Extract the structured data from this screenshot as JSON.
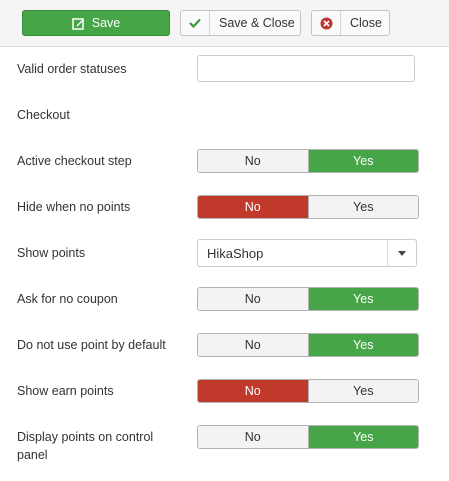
{
  "toolbar": {
    "save": {
      "label": "Save",
      "icon": "edit-icon"
    },
    "save_close": {
      "label": "Save & Close",
      "icon": "check-icon"
    },
    "close": {
      "label": "Close",
      "icon": "cancel-circle-icon"
    }
  },
  "form": {
    "valid_order_statuses": {
      "label": "Valid order statuses",
      "value": ""
    },
    "checkout_heading": "Checkout",
    "active_checkout_step": {
      "label": "Active checkout step",
      "no": "No",
      "yes": "Yes",
      "selected": "Yes"
    },
    "hide_when_no_points": {
      "label": "Hide when no points",
      "no": "No",
      "yes": "Yes",
      "selected": "No"
    },
    "show_points": {
      "label": "Show points",
      "selected": "HikaShop"
    },
    "ask_for_no_coupon": {
      "label": "Ask for no coupon",
      "no": "No",
      "yes": "Yes",
      "selected": "Yes"
    },
    "do_not_use_point_by_default": {
      "label": "Do not use point by default",
      "no": "No",
      "yes": "Yes",
      "selected": "Yes"
    },
    "show_earn_points": {
      "label": "Show earn points",
      "no": "No",
      "yes": "Yes",
      "selected": "No"
    },
    "display_points_on_control_panel": {
      "label": "Display points on control panel",
      "no": "No",
      "yes": "Yes",
      "selected": "Yes"
    }
  },
  "colors": {
    "green": "#46a546",
    "red": "#c0392b",
    "toolbar_bg": "#f5f5f5"
  }
}
